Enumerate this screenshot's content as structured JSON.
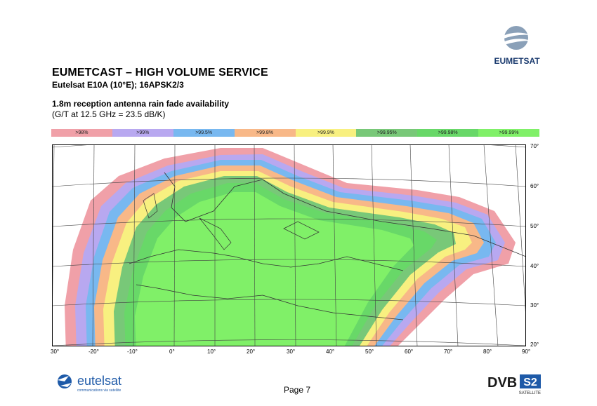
{
  "header": {
    "title": "EUMETCAST – HIGH VOLUME SERVICE",
    "subtitle": "Eutelsat E10A (10°E); 16APSK2/3",
    "heading": "1.8m reception antenna rain fade availability",
    "subheading": "(G/T at 12.5 GHz = 23.5 dB/K)"
  },
  "legend": [
    {
      "label": ">98%",
      "color": "#f0a0a8"
    },
    {
      "label": ">99%",
      "color": "#b8a8f0"
    },
    {
      "label": ">99.5%",
      "color": "#78b8f0"
    },
    {
      "label": ">99.8%",
      "color": "#f8b888"
    },
    {
      "label": ">99.9%",
      "color": "#f8f080"
    },
    {
      "label": ">99.95%",
      "color": "#78c878"
    },
    {
      "label": ">99.98%",
      "color": "#68d868"
    },
    {
      "label": ">99.99%",
      "color": "#80f068"
    }
  ],
  "map": {
    "lat_labels": [
      "70°",
      "60°",
      "50°",
      "40°",
      "30°",
      "20°"
    ],
    "lon_labels": [
      "30°",
      "-20°",
      "-10°",
      "0°",
      "10°",
      "20°",
      "30°",
      "40°",
      "50°",
      "60°",
      "70°",
      "80°",
      "90°"
    ]
  },
  "footer": {
    "page": "Page 7",
    "eutelsat_name": "eutelsat",
    "eutelsat_tagline": "communications via satellite",
    "eumetsat_name": "EUMETSAT",
    "dvb_text": "DVB",
    "s2_text": "S2",
    "satellite_text": "SATELLITE"
  }
}
